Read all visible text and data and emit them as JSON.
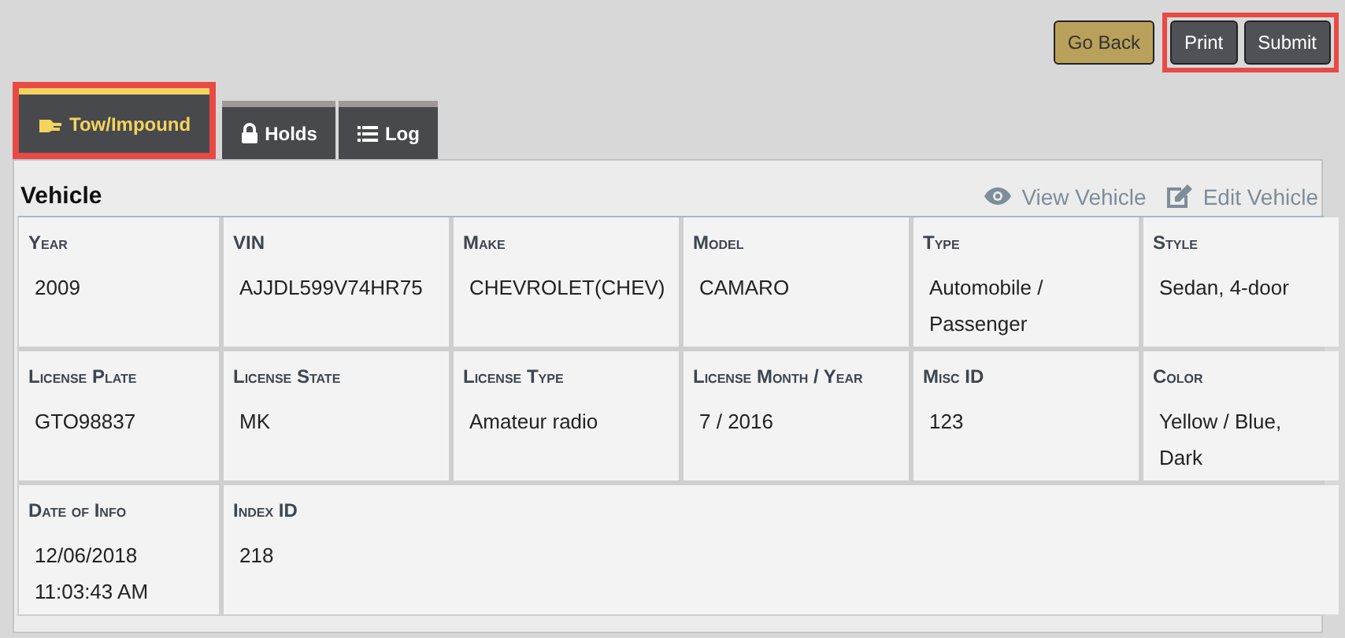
{
  "buttons": [
    {
      "label": "Go Back",
      "kind": "secondary",
      "highlighted": false
    },
    {
      "label": "Print",
      "kind": "primary",
      "highlighted": true
    },
    {
      "label": "Submit",
      "kind": "primary",
      "highlighted": true
    }
  ],
  "tabs": [
    {
      "label": "Tow/Impound",
      "kind": "tow",
      "selected": true,
      "highlighted": true
    },
    {
      "label": "Holds",
      "kind": "lock",
      "selected": false,
      "highlighted": false
    },
    {
      "label": "Log",
      "kind": "list",
      "selected": false,
      "highlighted": false
    }
  ],
  "section": {
    "title": "Vehicle",
    "actions": [
      {
        "label": "View Vehicle",
        "kind": "view"
      },
      {
        "label": "Edit Vehicle",
        "kind": "edit"
      }
    ]
  },
  "fields": [
    {
      "label": "Year",
      "value": "2009"
    },
    {
      "label": "VIN",
      "value": "AJJDL599V74HR75"
    },
    {
      "label": "Make",
      "value": "CHEVROLET(CHEV)"
    },
    {
      "label": "Model",
      "value": "CAMARO"
    },
    {
      "label": "Type",
      "value": "Automobile / Passenger"
    },
    {
      "label": "Style",
      "value": "Sedan, 4-door"
    },
    {
      "label": "License Plate",
      "value": "GTO98837"
    },
    {
      "label": "License State",
      "value": "MK"
    },
    {
      "label": "License Type",
      "value": "Amateur radio"
    },
    {
      "label": "License Month / Year",
      "value": "7 / 2016"
    },
    {
      "label": "Misc ID",
      "value": "123"
    },
    {
      "label": "Color",
      "value": "Yellow / Blue, Dark"
    },
    {
      "label": "Date of Info",
      "value": "12/06/2018 11:03:43 AM"
    },
    {
      "label": "Index ID",
      "value": "218",
      "kind": "wide"
    }
  ]
}
